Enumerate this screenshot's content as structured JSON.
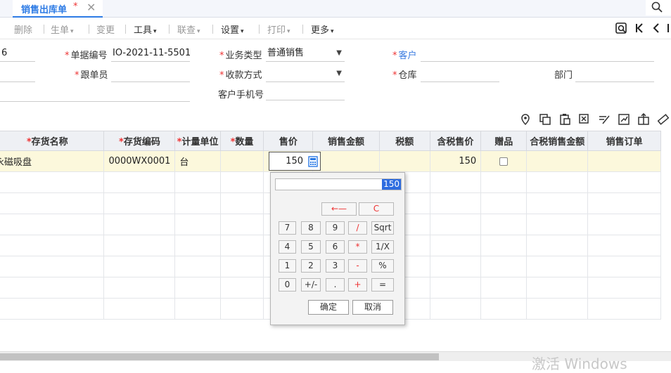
{
  "tab": {
    "title": "销售出库单",
    "modified_mark": "*",
    "close": "✕"
  },
  "toolbar": {
    "delete": "删除",
    "generate": "生单",
    "change": "变更",
    "tools": "工具",
    "inquiry": "联查",
    "settings": "设置",
    "print": "打印",
    "more": "更多"
  },
  "form": {
    "left_partial_value": "6",
    "doc_no_label": "单据编号",
    "doc_no": "IO-2021-11-5501",
    "biz_type_label": "业务类型",
    "biz_type": "普通销售",
    "customer_label": "客户",
    "customer": "",
    "follower_label": "跟单员",
    "follower": "",
    "payment_label": "收款方式",
    "payment": "",
    "warehouse_label": "仓库",
    "warehouse": "",
    "dept_label": "部门",
    "dept": "",
    "phone_label": "客户手机号",
    "phone": ""
  },
  "table": {
    "columns": [
      "存货名称",
      "存货编码",
      "计量单位",
      "数量",
      "售价",
      "销售金额",
      "税额",
      "含税售价",
      "赠品",
      "合税销售金额",
      "销售订单"
    ],
    "required": [
      true,
      true,
      true,
      true,
      false,
      false,
      false,
      false,
      false,
      false,
      false
    ],
    "rows": [
      {
        "name": "永磁吸盘",
        "code": "0000WX0001",
        "unit": "台",
        "qty": "",
        "price": "150",
        "amount": "",
        "tax": "",
        "tax_price": "150",
        "gift": false,
        "tax_amount": "",
        "order": ""
      }
    ]
  },
  "calculator": {
    "display": "150",
    "backspace": "←—",
    "clear": "C",
    "keys": [
      [
        "7",
        "8",
        "9",
        "/",
        "Sqrt"
      ],
      [
        "4",
        "5",
        "6",
        "*",
        "1/X"
      ],
      [
        "1",
        "2",
        "3",
        "-",
        "%"
      ],
      [
        "0",
        "+/-",
        ".",
        "+",
        "="
      ]
    ],
    "ok": "确定",
    "cancel": "取消"
  },
  "watermark": "激活 Windows",
  "colors": {
    "accent": "#2d7be5",
    "required": "#e33333",
    "active_row": "#fcf8dc",
    "header_bg": "#eef0f4"
  }
}
